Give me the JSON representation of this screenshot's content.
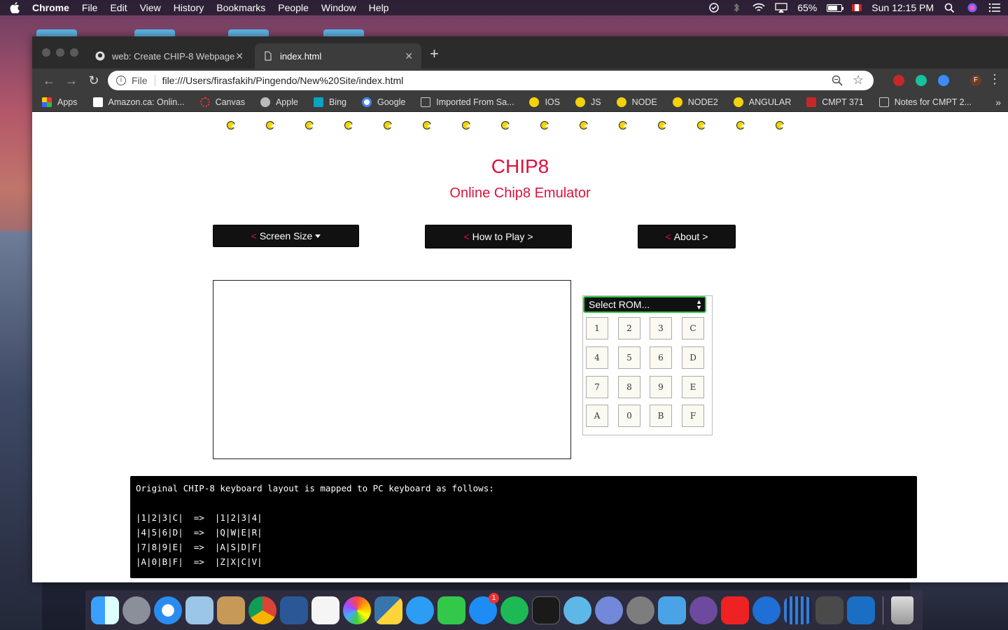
{
  "menubar": {
    "app": "Chrome",
    "items": [
      "File",
      "Edit",
      "View",
      "History",
      "Bookmarks",
      "People",
      "Window",
      "Help"
    ],
    "battery": "65%",
    "clock": "Sun 12:15 PM"
  },
  "browser": {
    "tabs": [
      {
        "title": "web: Create CHIP-8 Webpage",
        "active": false
      },
      {
        "title": "index.html",
        "active": true
      }
    ],
    "omnibox": {
      "scheme_label": "File",
      "url": "file:///Users/firasfakih/Pingendo/New%20Site/index.html"
    },
    "bookmarks": [
      "Apps",
      "Amazon.ca: Onlin...",
      "Canvas",
      "Apple",
      "Bing",
      "Google",
      "Imported From Sa...",
      "IOS",
      "JS",
      "NODE",
      "NODE2",
      "ANGULAR",
      "CMPT 371",
      "Notes for CMPT 2..."
    ],
    "profile_initial": "F"
  },
  "page": {
    "title": "CHIP8",
    "subtitle": "Online Chip8 Emulator",
    "buttons": {
      "screen_size": "Screen Size",
      "how_to_play": "How to Play",
      "about": "About",
      "left_mark": "<",
      "right_mark": ">"
    },
    "rom_select": "Select ROM...",
    "keypad": [
      "1",
      "2",
      "3",
      "C",
      "4",
      "5",
      "6",
      "D",
      "7",
      "8",
      "9",
      "E",
      "A",
      "0",
      "B",
      "F"
    ],
    "console": [
      "Original CHIP-8 keyboard layout is mapped to PC keyboard as follows:",
      "",
      "|1|2|3|C|  =>  |1|2|3|4|",
      "|4|5|6|D|  =>  |Q|W|E|R|",
      "|7|8|9|E|  =>  |A|S|D|F|",
      "|A|0|B|F|  =>  |Z|X|C|V|"
    ]
  },
  "dock": {
    "apps": [
      "finder-icon",
      "launchpad-icon",
      "safari-icon",
      "mail-icon",
      "contacts-icon",
      "chrome-icon",
      "word-icon",
      "reminders-icon",
      "photos-icon",
      "python-icon",
      "messages-icon",
      "facetime-icon",
      "app-store-icon",
      "spotify-icon",
      "terminal-icon",
      "vscode-blue-icon",
      "discord-icon",
      "system-preferences-icon",
      "xcode-icon",
      "github-icon",
      "acrobat-icon",
      "hex-icon",
      "bars-icon",
      "sublime-icon",
      "vscode-icon",
      "trash-icon"
    ],
    "app_store_badge": "1"
  },
  "colors": {
    "accent": "#e0103c",
    "select_border": "#2ecc40",
    "pacman": "#f3d20a"
  }
}
